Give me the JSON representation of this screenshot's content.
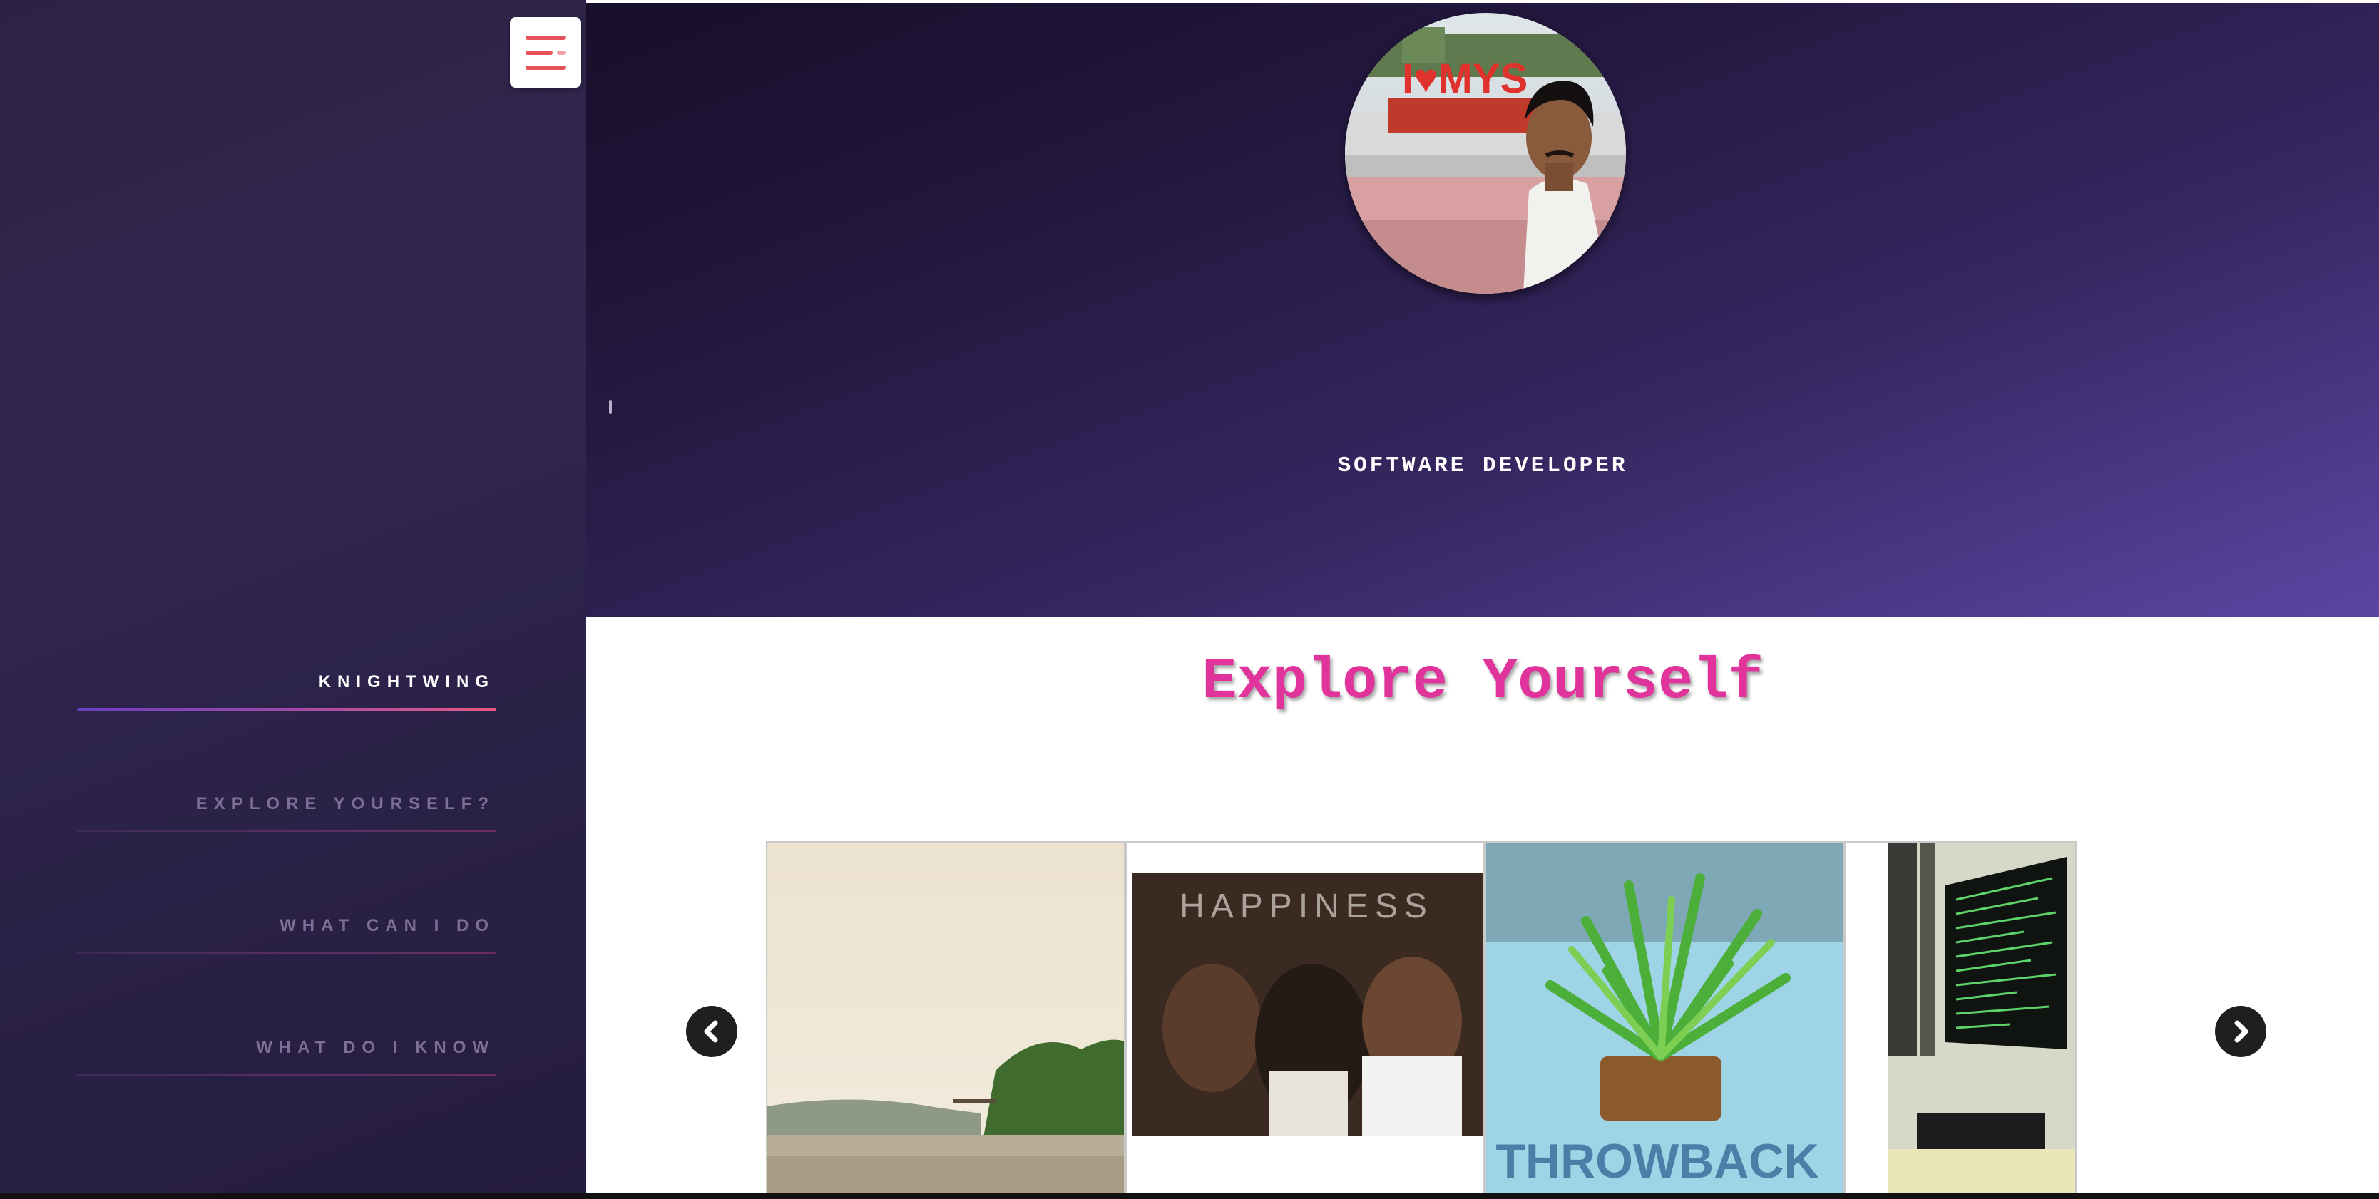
{
  "sidebar": {
    "menu_icon": "hamburger-menu-icon",
    "nav": [
      {
        "label": "KNIGHTWING",
        "active": true
      },
      {
        "label": "EXPLORE YOURSELF?",
        "active": false
      },
      {
        "label": "WHAT CAN I DO",
        "active": false
      },
      {
        "label": "WHAT DO I KNOW",
        "active": false
      }
    ]
  },
  "hero": {
    "role": "SOFTWARE DEVELOPER",
    "avatar_sign_text": "I♥MYS"
  },
  "explore": {
    "title": "Explore Yourself",
    "cards": [
      {
        "icon": "lake-photo"
      },
      {
        "overlay_text": "HAPPINESS"
      },
      {
        "overlay_text": "THROWBACK"
      },
      {
        "icon": "terminal-monitor-photo"
      }
    ],
    "prev_icon": "chevron-left-icon",
    "next_icon": "chevron-right-icon"
  },
  "colors": {
    "accent_pink": "#e0339c",
    "menu_red": "#e5525c",
    "sidebar_bg": "#2c2344",
    "hero_end": "#5b46a3"
  }
}
